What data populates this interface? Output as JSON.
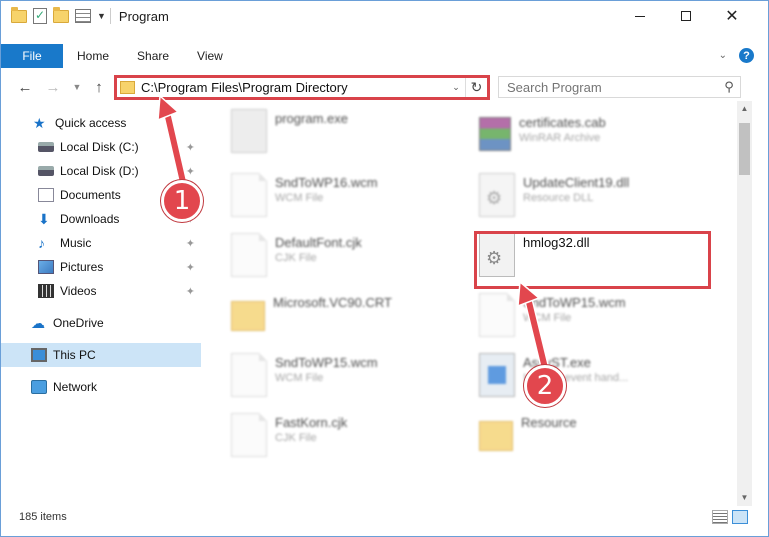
{
  "window": {
    "title": "Program"
  },
  "ribbon": {
    "tabs": [
      "File",
      "Home",
      "Share",
      "View"
    ]
  },
  "address": {
    "path": "C:\\Program Files\\Program Directory"
  },
  "search": {
    "placeholder": "Search Program"
  },
  "nav": {
    "items": [
      {
        "label": "Quick access",
        "icon": "star-icon"
      },
      {
        "label": "Local Disk (C:)",
        "icon": "drive-icon",
        "pinned": true
      },
      {
        "label": "Local Disk (D:)",
        "icon": "drive-icon",
        "pinned": true
      },
      {
        "label": "Documents",
        "icon": "documents-icon",
        "pinned": true
      },
      {
        "label": "Downloads",
        "icon": "download-icon",
        "pinned": true
      },
      {
        "label": "Music",
        "icon": "music-icon",
        "pinned": true
      },
      {
        "label": "Pictures",
        "icon": "pictures-icon",
        "pinned": true
      },
      {
        "label": "Videos",
        "icon": "videos-icon",
        "pinned": true
      },
      {
        "label": "OneDrive",
        "icon": "cloud-icon"
      },
      {
        "label": "This PC",
        "icon": "computer-icon",
        "selected": true
      },
      {
        "label": "Network",
        "icon": "network-icon"
      }
    ]
  },
  "files": {
    "left": [
      {
        "name": "program.exe",
        "type": ""
      },
      {
        "name": "SndToWP16.wcm",
        "type": "WCM File"
      },
      {
        "name": "DefaultFont.cjk",
        "type": "CJK File"
      },
      {
        "name": "Microsoft.VC90.CRT",
        "type": ""
      },
      {
        "name": "SndToWP15.wcm",
        "type": "WCM File"
      },
      {
        "name": "FastKorn.cjk",
        "type": "CJK File"
      }
    ],
    "right": [
      {
        "name": "certificates.cab",
        "type": "WinRAR Archive"
      },
      {
        "name": "UpdateClient19.dll",
        "type": "Resource DLL"
      },
      {
        "name": "hmlog32.dll",
        "type": ""
      },
      {
        "name": "SndToWP15.wcm",
        "type": "WCM File"
      },
      {
        "name": "AssyST.exe",
        "type": "Installer event hand..."
      },
      {
        "name": "Resource",
        "type": ""
      }
    ]
  },
  "status": {
    "count": "185 items"
  },
  "annotations": {
    "step1": "1",
    "step2": "2"
  },
  "colors": {
    "accent": "#1979ca",
    "highlight": "#d9434a",
    "badge": "#e2474e"
  }
}
